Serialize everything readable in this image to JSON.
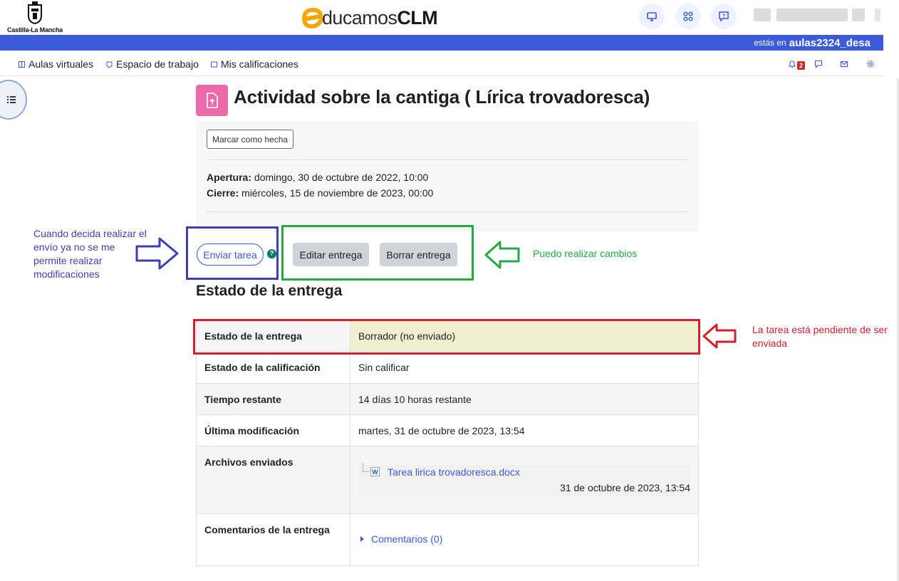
{
  "header": {
    "region_name": "Castilla-La Mancha",
    "logo_part1": "ducamos",
    "logo_part2": "CLM",
    "icons": [
      "monitor-icon",
      "apps-grid-icon",
      "help-chat-icon"
    ],
    "location_prefix": "estás en",
    "location_name": "aulas2324_desa"
  },
  "nav": {
    "items": [
      {
        "label": "Aulas virtuales",
        "icon": "square-icon"
      },
      {
        "label": "Espacio de trabajo",
        "icon": "shield-icon"
      },
      {
        "label": "Mis calificaciones",
        "icon": "square-icon"
      }
    ],
    "notifications_count": "2",
    "right_icons": [
      "bell-icon",
      "chat-icon",
      "mail-icon",
      "settings-icon"
    ]
  },
  "activity": {
    "title": "Actividad sobre la cantiga ( Lírica trovadoresca)",
    "mark_done_label": "Marcar como hecha",
    "opening_label": "Apertura:",
    "opening_value": "domingo, 30 de octubre de 2022, 10:00",
    "closing_label": "Cierre:",
    "closing_value": "miércoles, 15 de noviembre de 2023, 00:00"
  },
  "actions": {
    "submit_label": "Enviar tarea",
    "help_glyph": "?",
    "edit_label": "Editar entrega",
    "delete_label": "Borrar entrega"
  },
  "annotations": {
    "left_note": "Cuando decida realizar el envío ya no se me permite realizar modificaciones",
    "right_note": "Puedo realizar cambios",
    "status_note": "La tarea está pendiente de ser enviada",
    "colors": {
      "blue": "#3f3fb0",
      "green": "#27a844",
      "red": "#d62030"
    }
  },
  "status": {
    "section_title": "Estado de la entrega",
    "rows": [
      {
        "key": "Estado de la entrega",
        "value": "Borrador (no enviado)"
      },
      {
        "key": "Estado de la calificación",
        "value": "Sin calificar"
      },
      {
        "key": "Tiempo restante",
        "value": "14 días 10 horas restante"
      },
      {
        "key": "Última modificación",
        "value": "martes, 31 de octubre de 2023, 13:54"
      },
      {
        "key": "Archivos enviados",
        "file_name": "Tarea lirica trovadoresca.docx",
        "file_date": "31 de octubre de 2023, 13:54"
      },
      {
        "key": "Comentarios de la entrega",
        "comments_label": "Comentarios (0)"
      }
    ]
  }
}
